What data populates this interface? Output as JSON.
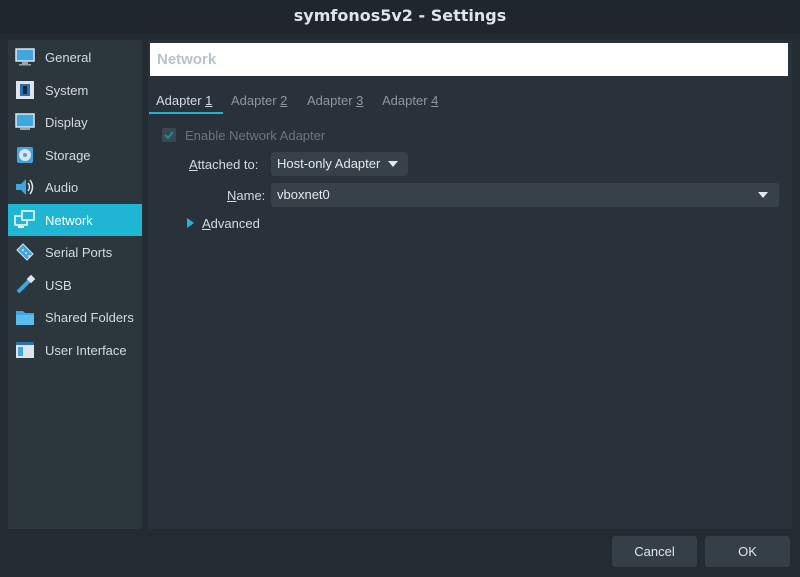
{
  "window": {
    "title": "symfonos5v2 - Settings"
  },
  "sidebar": {
    "items": [
      {
        "label": "General",
        "icon": "monitor-general-icon"
      },
      {
        "label": "System",
        "icon": "chip-system-icon"
      },
      {
        "label": "Display",
        "icon": "display-icon"
      },
      {
        "label": "Storage",
        "icon": "storage-disc-icon"
      },
      {
        "label": "Audio",
        "icon": "audio-speaker-icon"
      },
      {
        "label": "Network",
        "icon": "network-icon",
        "selected": true
      },
      {
        "label": "Serial Ports",
        "icon": "serial-port-icon"
      },
      {
        "label": "USB",
        "icon": "usb-icon"
      },
      {
        "label": "Shared Folders",
        "icon": "folder-icon"
      },
      {
        "label": "User Interface",
        "icon": "window-ui-icon"
      }
    ]
  },
  "main": {
    "title": "Network",
    "tabs": [
      {
        "label": "Adapter ",
        "key": "1",
        "active": true
      },
      {
        "label": "Adapter ",
        "key": "2"
      },
      {
        "label": "Adapter ",
        "key": "3"
      },
      {
        "label": "Adapter ",
        "key": "4"
      }
    ],
    "enable_adapter": {
      "label": "Enable Network Adapter",
      "checked": true,
      "disabled": true
    },
    "attached_to": {
      "label_key": "A",
      "label_rest": "ttached to:",
      "value": "Host-only Adapter"
    },
    "name": {
      "label_key": "N",
      "label_rest": "ame:",
      "value": "vboxnet0"
    },
    "advanced": {
      "label_key": "A",
      "label_rest": "dvanced"
    }
  },
  "footer": {
    "cancel_label": "Cancel",
    "ok_label": "OK"
  },
  "colors": {
    "accent": "#1fb6d4",
    "background": "#232c33",
    "panel": "#2c363d"
  }
}
